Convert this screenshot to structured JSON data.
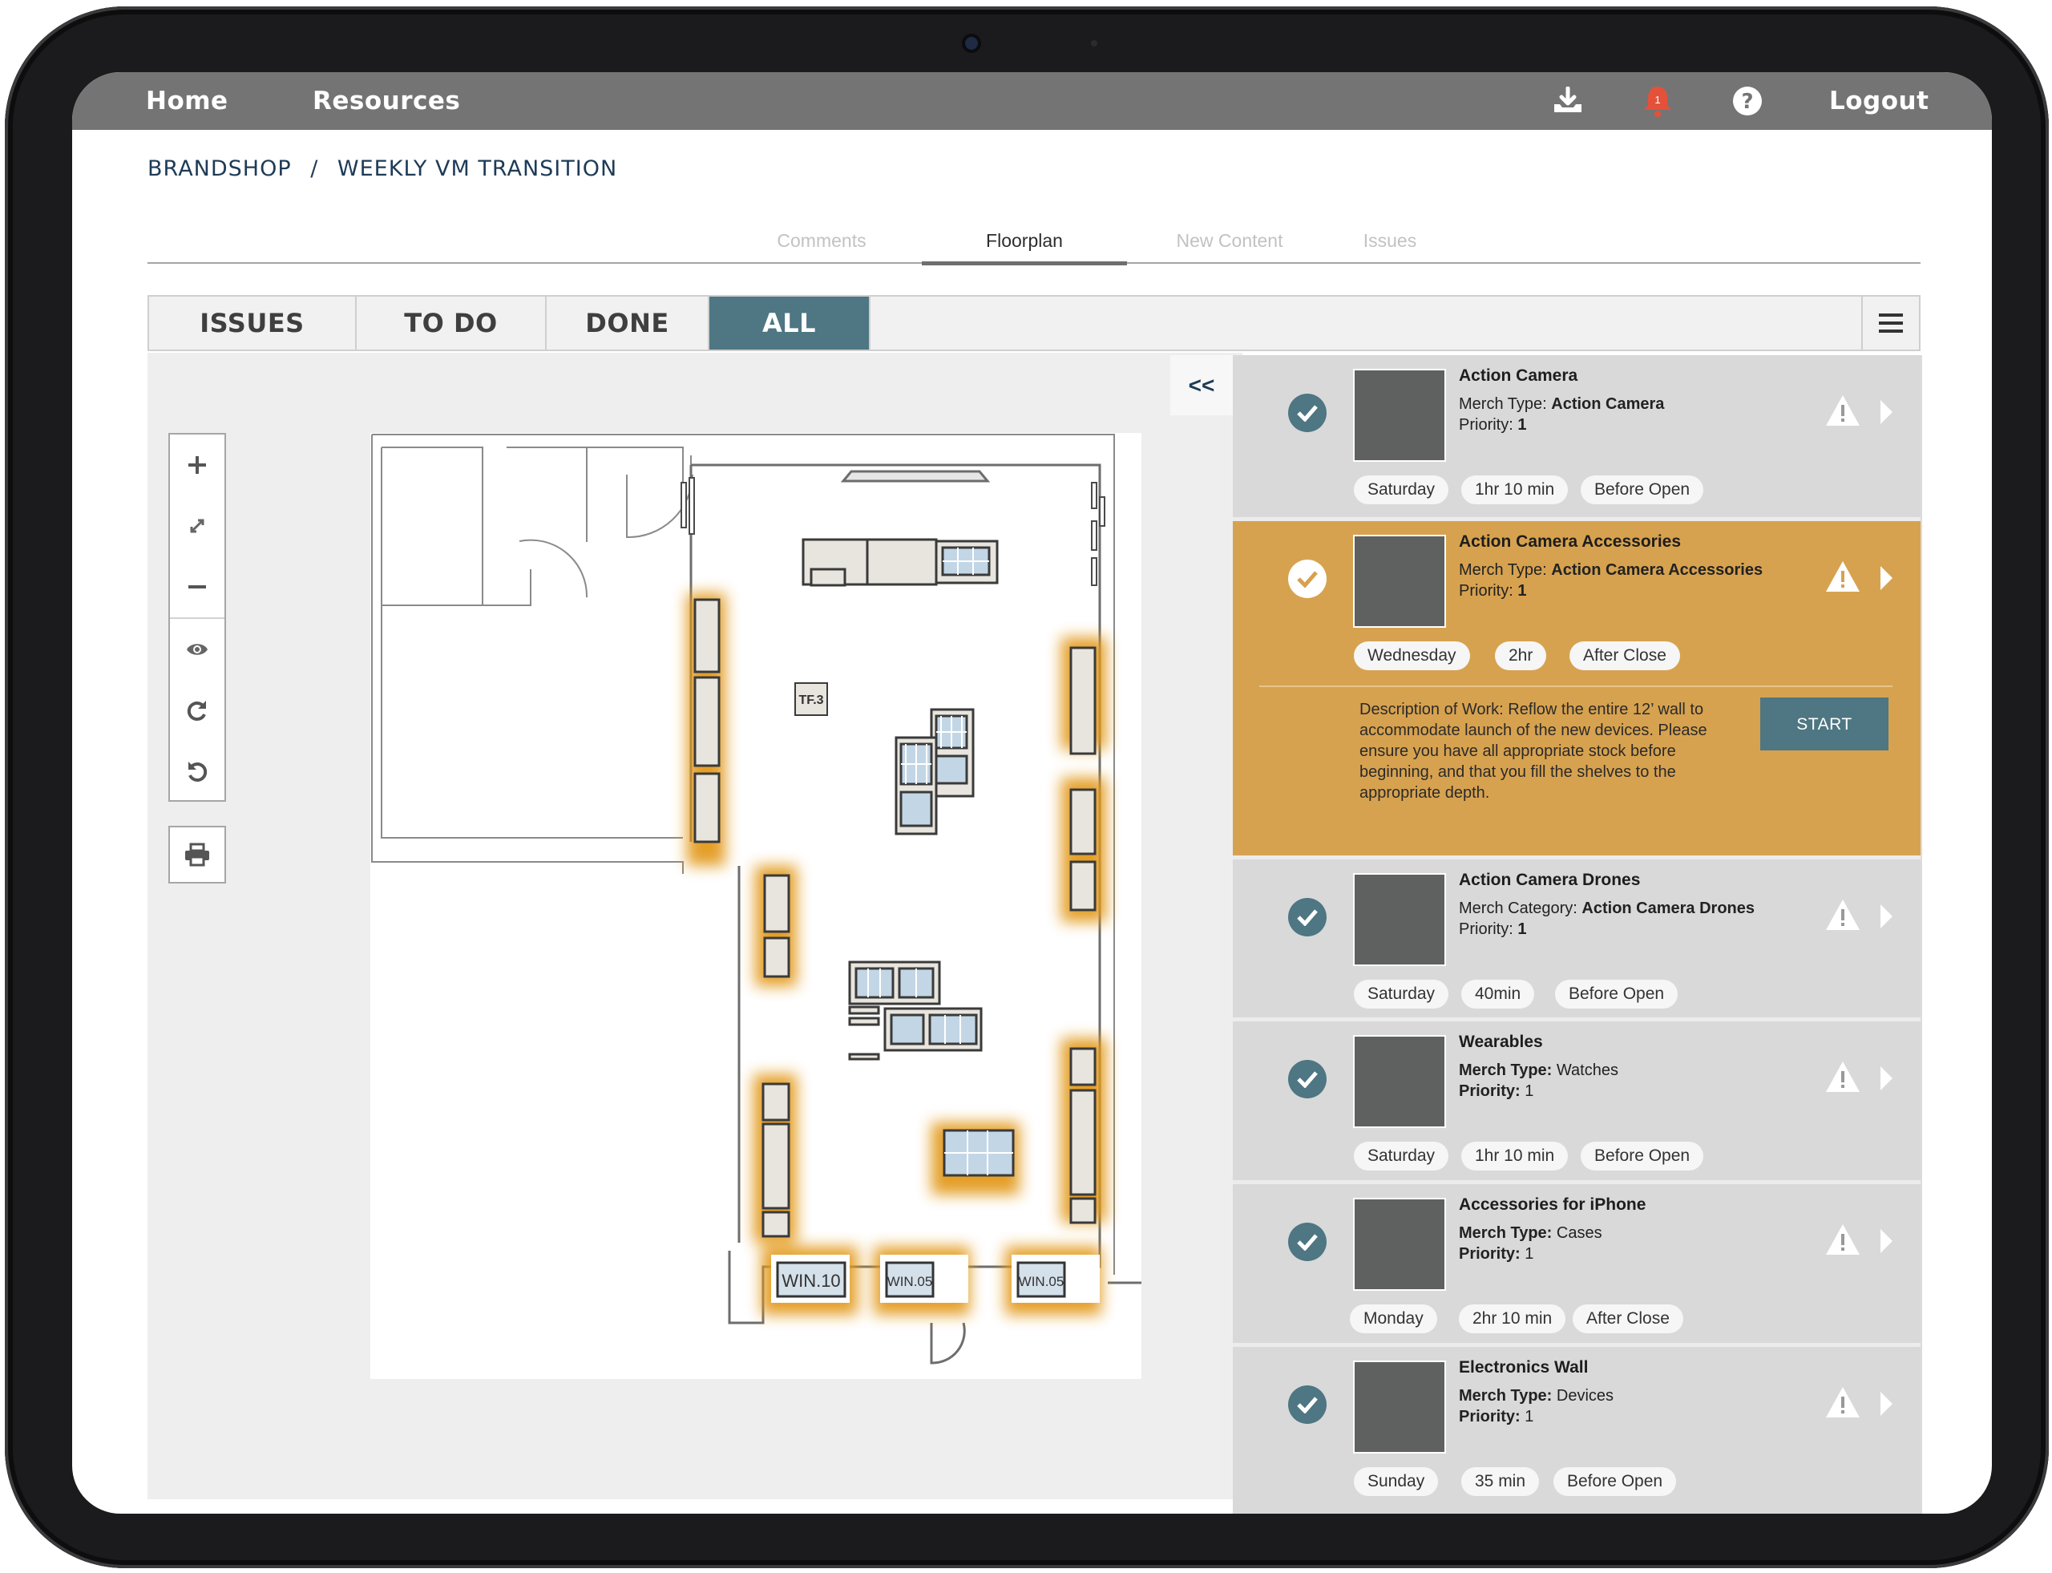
{
  "nav": {
    "home": "Home",
    "resources": "Resources",
    "logout": "Logout",
    "notification_count": "1"
  },
  "breadcrumb": {
    "store": "BRANDSHOP",
    "separator": "/",
    "task": "WEEKLY VM TRANSITION"
  },
  "tabs": [
    "Comments",
    "Floorplan",
    "New Content",
    "Issues"
  ],
  "filters": [
    "ISSUES",
    "TO DO",
    "DONE",
    "ALL"
  ],
  "collapse_label": "<<",
  "colors": {
    "accent": "#4e7683",
    "highlight": "#d7a24f",
    "topbar": "#747474",
    "alert": "#e4513a",
    "glow": "#e39a1e"
  },
  "icons": {
    "toolbar": [
      "download-icon",
      "bell-icon",
      "help-icon"
    ],
    "map_tools": [
      "zoom-in-icon",
      "expand-icon",
      "zoom-out-icon",
      "eye-icon",
      "redo-icon",
      "undo-icon",
      "print-icon"
    ]
  },
  "floorplan": {
    "tf_label": "TF.3",
    "windows": [
      "WIN.10",
      "WIN.05",
      "WIN.05"
    ]
  },
  "cards": [
    {
      "title": "Action Camera",
      "type_label": "Merch Type:",
      "type_value": "Action Camera",
      "priority_label": "Priority:",
      "priority_value": "1",
      "day": "Saturday",
      "duration": "1hr 10 min",
      "timing": "Before Open"
    },
    {
      "title": "Action Camera Accessories",
      "type_label": "Merch Type:",
      "type_value": "Action Camera Accessories",
      "priority_label": "Priority:",
      "priority_value": "1",
      "day": "Wednesday",
      "duration": "2hr",
      "timing": "After Close",
      "description": "Description of Work: Reflow the entire 12’ wall to accommodate launch of the new devices. Please ensure you have all appropriate stock before beginning, and that you fill the shelves to the appropriate depth.",
      "start": "START"
    },
    {
      "title": "Action Camera Drones",
      "type_label": "Merch Category:",
      "type_value": "Action Camera Drones",
      "priority_label": "Priority:",
      "priority_value": "1",
      "day": "Saturday",
      "duration": "40min",
      "timing": "Before Open"
    },
    {
      "title": "Wearables",
      "type_label": "Merch Type:",
      "type_value": "Watches",
      "priority_label": "Priority:",
      "priority_value": "1",
      "day": "Saturday",
      "duration": "1hr 10 min",
      "timing": "Before Open"
    },
    {
      "title": "Accessories for iPhone",
      "type_label": "Merch Type:",
      "type_value": "Cases",
      "priority_label": "Priority:",
      "priority_value": "1",
      "day": "Monday",
      "duration": "2hr 10 min",
      "timing": "After Close"
    },
    {
      "title": "Electronics Wall",
      "type_label": "Merch Type:",
      "type_value": "Devices",
      "priority_label": "Priority:",
      "priority_value": "1",
      "day": "Sunday",
      "duration": "35 min",
      "timing": "Before Open"
    }
  ]
}
